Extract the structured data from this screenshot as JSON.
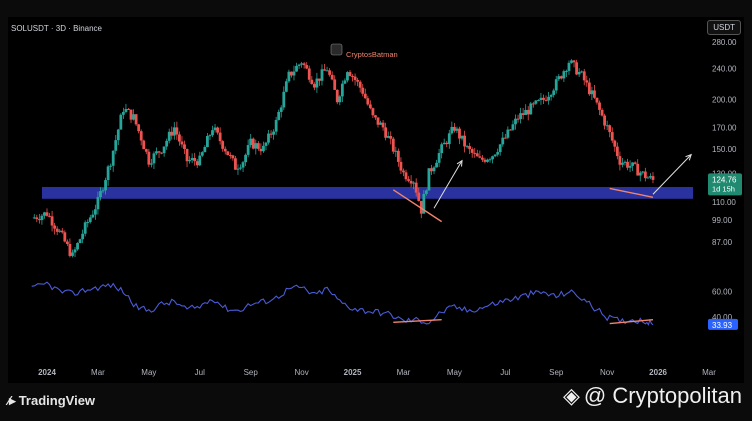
{
  "header": {
    "title": "SOLUSDT · 3D · Binance",
    "currency": "USDT",
    "annotation": "CryptosBatman"
  },
  "price_badge": {
    "price": "124.76",
    "countdown": "1d 15h"
  },
  "rsi_badge": "33.93",
  "footer": {
    "brand": "TradingView",
    "watermark": "@ Cryptopolitan"
  },
  "colors": {
    "up": "#26a69a",
    "down": "#ef5350",
    "support_band": "#2b35a8",
    "rsi_line": "#4a5bd8",
    "divergence": "#f0846e",
    "arrow": "#e0e0e0",
    "badge_green": "#1f8a70",
    "badge_blue": "#2962ff"
  },
  "chart_data": [
    {
      "type": "candlestick",
      "title": "SOLUSDT · 3D · Binance",
      "y_scale": "log",
      "price_ticks": [
        280,
        240,
        200,
        170,
        150,
        130,
        110,
        99,
        87
      ],
      "x_ticks": [
        "2024",
        "Mar",
        "May",
        "Jul",
        "Sep",
        "Nov",
        "2025",
        "Mar",
        "May",
        "Jul",
        "Sep",
        "Nov",
        "2026",
        "Mar"
      ],
      "x_tick_time": [
        0,
        2,
        4,
        6,
        8,
        10,
        12,
        14,
        16,
        18,
        20,
        22,
        24,
        26
      ],
      "support_zone": [
        112,
        120
      ],
      "close_path": [
        [
          -0.6,
          100
        ],
        [
          0,
          103
        ],
        [
          0.5,
          92
        ],
        [
          1,
          80
        ],
        [
          1.5,
          95
        ],
        [
          2,
          110
        ],
        [
          2.5,
          140
        ],
        [
          3,
          190
        ],
        [
          3.4,
          180
        ],
        [
          3.7,
          160
        ],
        [
          4,
          140
        ],
        [
          4.5,
          150
        ],
        [
          5,
          170
        ],
        [
          5.5,
          140
        ],
        [
          6,
          140
        ],
        [
          6.5,
          170
        ],
        [
          7,
          150
        ],
        [
          7.4,
          135
        ],
        [
          7.7,
          140
        ],
        [
          8,
          155
        ],
        [
          8.5,
          150
        ],
        [
          9,
          175
        ],
        [
          9.5,
          230
        ],
        [
          10,
          250
        ],
        [
          10.5,
          220
        ],
        [
          11,
          240
        ],
        [
          11.4,
          200
        ],
        [
          11.8,
          240
        ],
        [
          12,
          230
        ],
        [
          12.4,
          210
        ],
        [
          12.8,
          180
        ],
        [
          13.2,
          170
        ],
        [
          13.6,
          150
        ],
        [
          14,
          130
        ],
        [
          14.4,
          125
        ],
        [
          14.7,
          105
        ],
        [
          15,
          130
        ],
        [
          15.5,
          150
        ],
        [
          16,
          170
        ],
        [
          16.5,
          150
        ],
        [
          17,
          140
        ],
        [
          17.5,
          145
        ],
        [
          18,
          160
        ],
        [
          18.5,
          180
        ],
        [
          19,
          190
        ],
        [
          19.5,
          200
        ],
        [
          20,
          220
        ],
        [
          20.5,
          250
        ],
        [
          21,
          230
        ],
        [
          21.5,
          200
        ],
        [
          22,
          170
        ],
        [
          22.5,
          140
        ],
        [
          23,
          135
        ],
        [
          23.5,
          128
        ],
        [
          23.8,
          124.76
        ]
      ],
      "trendlines": [
        {
          "kind": "divergence",
          "from": [
            13.6,
            118
          ],
          "to": [
            15.5,
            98
          ]
        },
        {
          "kind": "divergence",
          "from": [
            22.1,
            119
          ],
          "to": [
            23.8,
            113
          ]
        }
      ],
      "arrows": [
        {
          "from": [
            15.2,
            106
          ],
          "to": [
            16.3,
            140
          ]
        },
        {
          "from": [
            23.8,
            115
          ],
          "to": [
            25.3,
            145
          ]
        }
      ]
    },
    {
      "type": "line",
      "title": "RSI",
      "y_ticks": [
        60,
        40
      ],
      "ylim": [
        30,
        75
      ],
      "series": [
        {
          "values": [
            [
              -0.6,
              62
            ],
            [
              0,
              66
            ],
            [
              0.5,
              60
            ],
            [
              1,
              58
            ],
            [
              1.5,
              61
            ],
            [
              2,
              63
            ],
            [
              2.5,
              65
            ],
            [
              3,
              60
            ],
            [
              3.5,
              48
            ],
            [
              4,
              45
            ],
            [
              4.5,
              50
            ],
            [
              5,
              52
            ],
            [
              5.5,
              46
            ],
            [
              6,
              48
            ],
            [
              6.5,
              55
            ],
            [
              7,
              47
            ],
            [
              7.5,
              45
            ],
            [
              8,
              50
            ],
            [
              8.5,
              52
            ],
            [
              9,
              55
            ],
            [
              9.5,
              62
            ],
            [
              10,
              63
            ],
            [
              10.5,
              57
            ],
            [
              11,
              62
            ],
            [
              11.5,
              52
            ],
            [
              12,
              47
            ],
            [
              12.5,
              45
            ],
            [
              13,
              44
            ],
            [
              13.5,
              42
            ],
            [
              14,
              37
            ],
            [
              14.5,
              38
            ],
            [
              15,
              36
            ],
            [
              15.5,
              44
            ],
            [
              16,
              48
            ],
            [
              16.5,
              45
            ],
            [
              17,
              47
            ],
            [
              17.5,
              50
            ],
            [
              18,
              53
            ],
            [
              18.5,
              55
            ],
            [
              19,
              58
            ],
            [
              19.5,
              59
            ],
            [
              20,
              56
            ],
            [
              20.5,
              60
            ],
            [
              21,
              55
            ],
            [
              21.5,
              47
            ],
            [
              22,
              40
            ],
            [
              22.5,
              37
            ],
            [
              23,
              38
            ],
            [
              23.5,
              37
            ],
            [
              23.8,
              33.93
            ]
          ]
        }
      ],
      "trendlines": [
        {
          "kind": "divergence",
          "from": [
            13.6,
            36
          ],
          "to": [
            15.5,
            38
          ]
        },
        {
          "kind": "divergence",
          "from": [
            22.1,
            35
          ],
          "to": [
            23.8,
            38
          ]
        }
      ]
    }
  ]
}
